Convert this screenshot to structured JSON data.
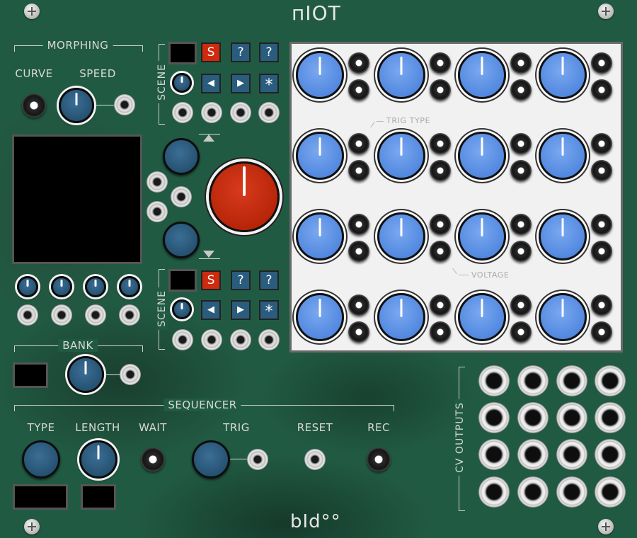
{
  "module": {
    "title": "пIOT",
    "brand": "bId°°"
  },
  "morphing": {
    "section_label": "MORPHING",
    "curve_label": "CURVE",
    "speed_label": "SPEED"
  },
  "scenes": {
    "label": "SCENE",
    "top": {
      "buttons": [
        "S",
        "?",
        "?"
      ],
      "nav": [
        "◀",
        "▶",
        "*"
      ]
    },
    "bottom": {
      "buttons": [
        "S",
        "?",
        "?"
      ],
      "nav": [
        "◀",
        "▶",
        "*"
      ]
    }
  },
  "grid": {
    "trig_type_label": "TRIG TYPE",
    "voltage_label": "VOLTAGE"
  },
  "bank": {
    "label": "BANK"
  },
  "sequencer": {
    "label": "SEQUENCER",
    "type_label": "TYPE",
    "length_label": "LENGTH",
    "wait_label": "WAIT",
    "trig_label": "TRIG",
    "reset_label": "RESET",
    "rec_label": "REC"
  },
  "cv_outputs": {
    "label": "CV OUTPUTS"
  },
  "colors": {
    "panel": "#215a43",
    "knob_dark": "#24506f",
    "knob_blue": "#4f86de",
    "knob_red": "#b52408",
    "button_red": "#cf2a0e",
    "button_blue": "#2a5c7e",
    "grid_background": "#f1f1f1"
  }
}
